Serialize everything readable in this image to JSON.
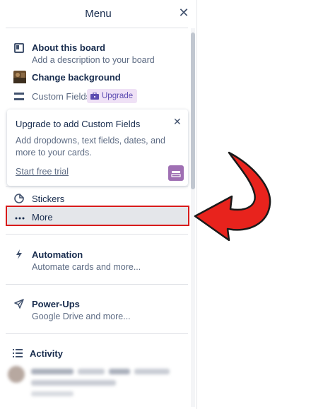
{
  "header": {
    "title": "Menu",
    "close_symbol": "✕"
  },
  "items": {
    "about": {
      "label": "About this board",
      "sub": "Add a description to your board",
      "icon": "board-icon"
    },
    "background": {
      "label": "Change background",
      "icon": "background-thumbnail"
    },
    "custom_fields": {
      "label": "Custom Fields",
      "badge": "Upgrade",
      "icon": "custom-fields-icon"
    },
    "stickers": {
      "label": "Stickers",
      "icon": "sticker-icon"
    },
    "more": {
      "label": "More",
      "icon": "ellipsis-icon"
    },
    "automation": {
      "label": "Automation",
      "sub": "Automate cards and more...",
      "icon": "lightning-icon"
    },
    "powerups": {
      "label": "Power-Ups",
      "sub": "Google Drive and more...",
      "icon": "rocket-icon"
    },
    "activity": {
      "label": "Activity",
      "icon": "list-icon"
    }
  },
  "upgrade_card": {
    "title": "Upgrade to add Custom Fields",
    "description": "Add dropdowns, text fields, dates, and more to your cards.",
    "link": "Start free trial",
    "close_symbol": "✕"
  },
  "colors": {
    "highlight_border": "#d81b1b",
    "arrow_fill": "#e8231d",
    "badge_bg": "#efe1f6",
    "badge_text": "#5e4db2"
  }
}
